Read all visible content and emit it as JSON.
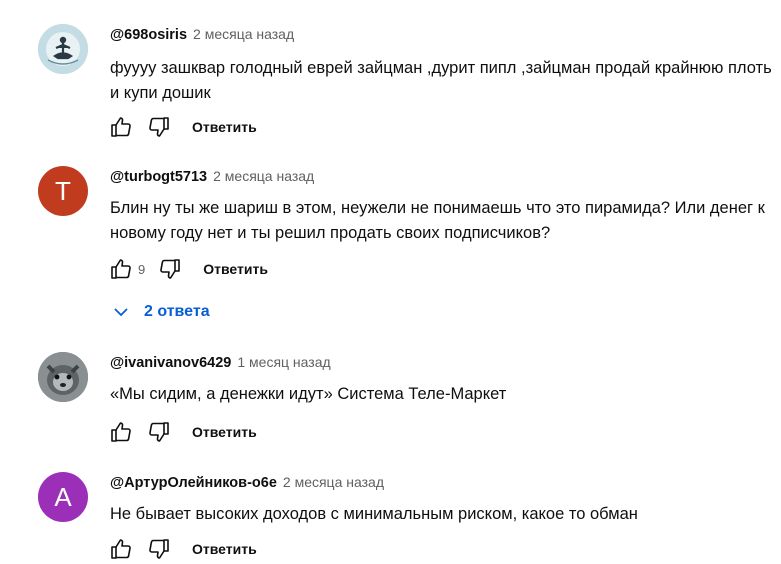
{
  "comments": [
    {
      "author": "@698osiris",
      "time": "2 месяца назад",
      "text": "фуууу зашквар голодный еврей зайцман ,дурит пипл ,зайцман продай крайнюю плоть и купи дошик",
      "likes": "",
      "reply_label": "Ответить",
      "avatar": {
        "type": "image",
        "icon": "meditation-figure-icon",
        "color": "#b7d3dd"
      }
    },
    {
      "author": "@turbogt5713",
      "time": "2 месяца назад",
      "text": "Блин ну ты же шариш в этом, неужели не понимаешь что это пирамида? Или денег к новому году нет и ты решил продать своих подписчиков?",
      "likes": "9",
      "reply_label": "Ответить",
      "avatar": {
        "type": "letter",
        "letter": "Т",
        "color": "#c13c1f"
      }
    },
    {
      "author": "@ivanivanov6429",
      "time": "1 месяц назад",
      "text": "«Мы сидим, а денежки идут» Система Теле-Маркет",
      "likes": "",
      "reply_label": "Ответить",
      "avatar": {
        "type": "image",
        "icon": "animal-photo-icon",
        "color": "#6e6e6e"
      }
    },
    {
      "author": "@АртурОлейников-о6е",
      "time": "2 месяца назад",
      "text": "Не бывает высоких доходов с минимальным риском,  какое то обман",
      "likes": "",
      "reply_label": "Ответить",
      "avatar": {
        "type": "letter",
        "letter": "А",
        "color": "#9c2fb7"
      }
    }
  ],
  "replies_toggle": {
    "label": "2 ответа",
    "color": "#065fd4"
  }
}
